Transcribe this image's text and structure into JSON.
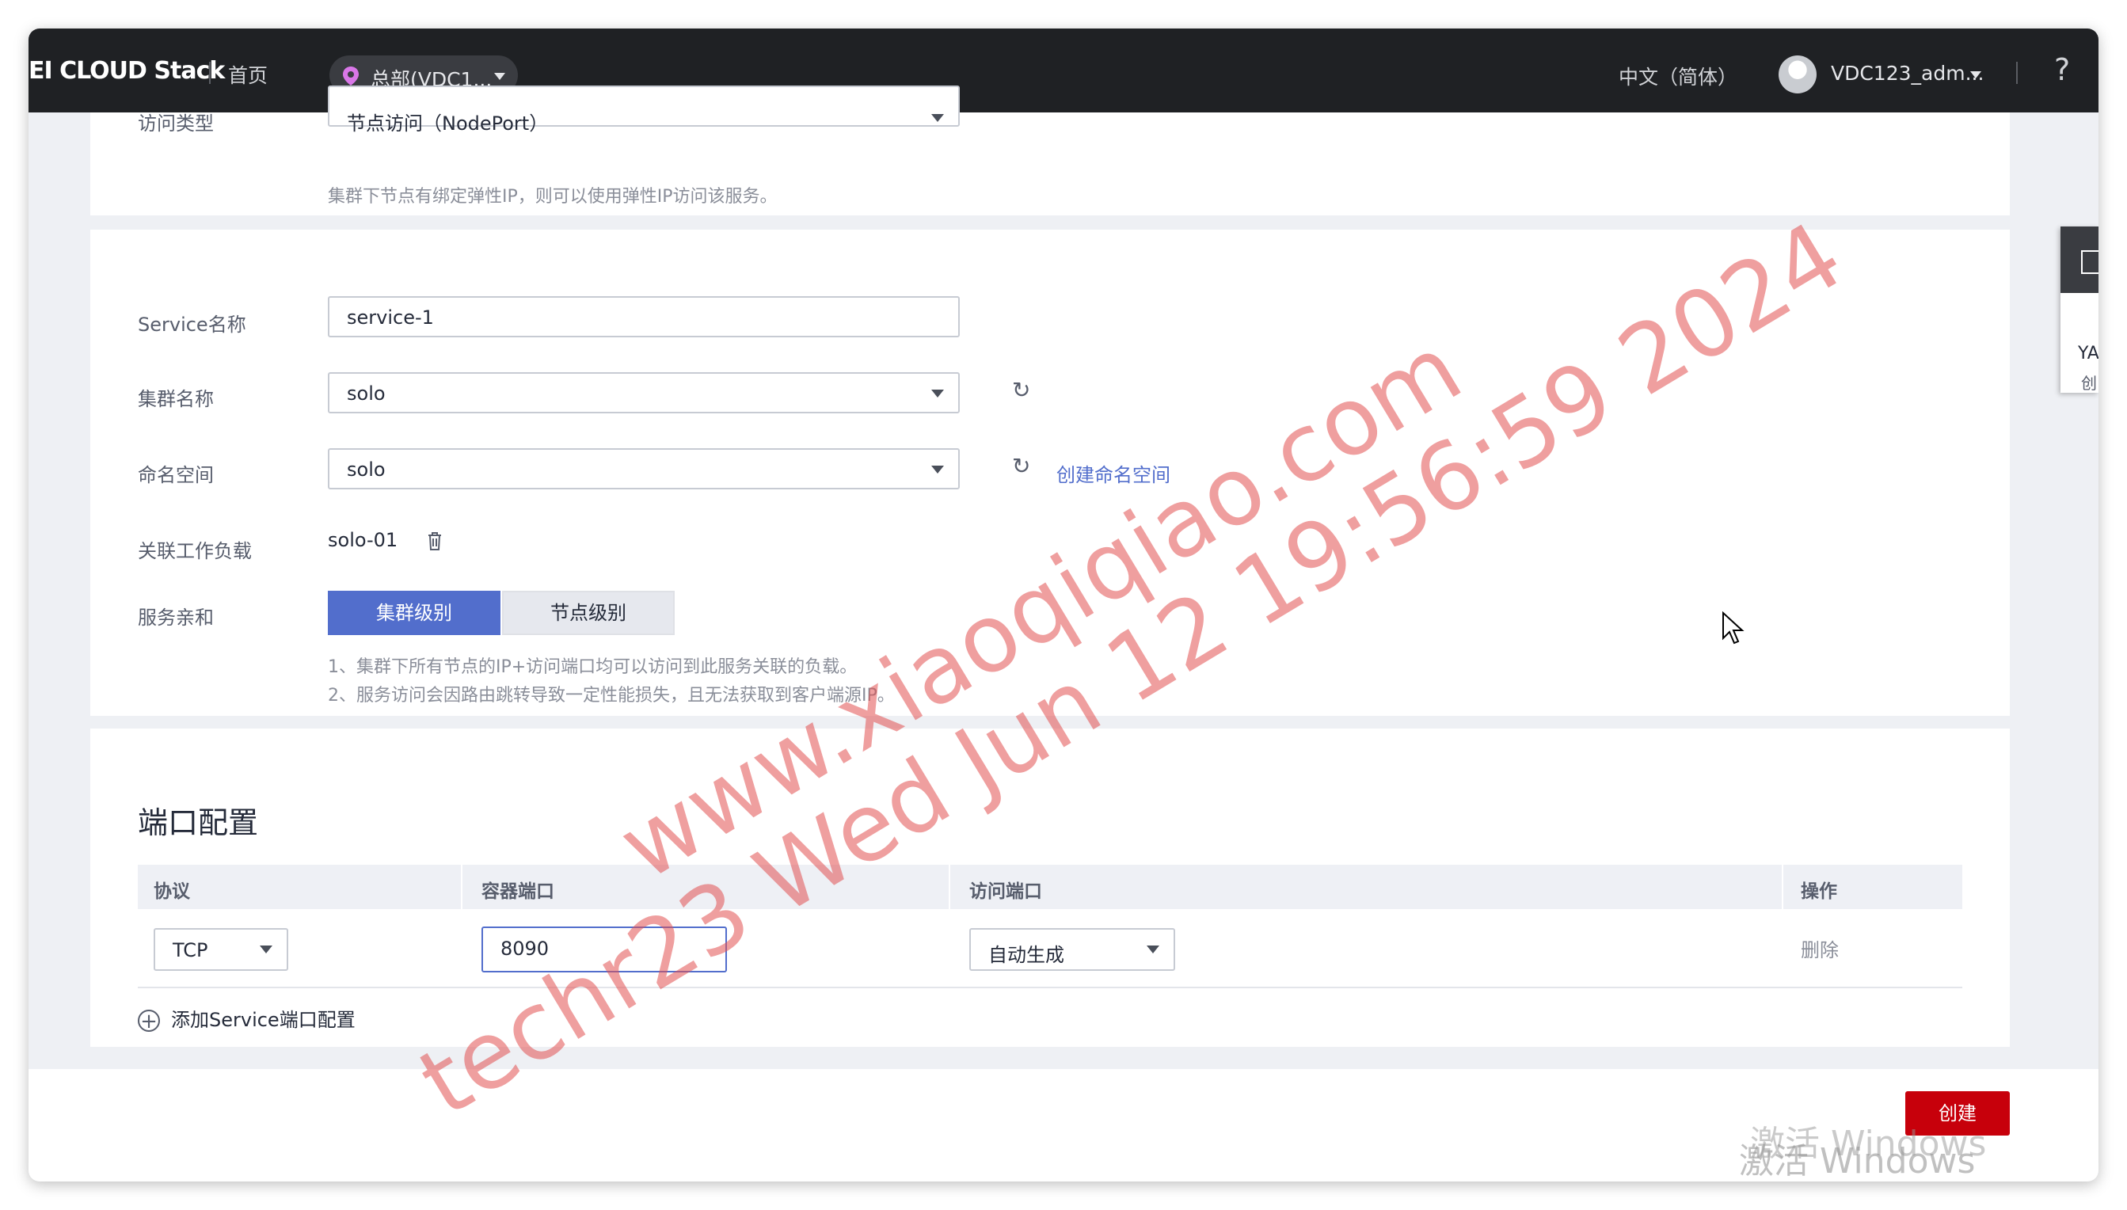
{
  "topbar": {
    "brand": "EI CLOUD Stack",
    "home": "首页",
    "region": "总部(VDC1...",
    "language": "中文（简体）",
    "user": "VDC123_adm...",
    "help": "?"
  },
  "access": {
    "label": "访问类型",
    "value": "节点访问（NodePort）",
    "hint": "集群下节点有绑定弹性IP，则可以使用弹性IP访问该服务。"
  },
  "service": {
    "name_label": "Service名称",
    "name_value": "service-1",
    "cluster_label": "集群名称",
    "cluster_value": "solo",
    "namespace_label": "命名空间",
    "namespace_value": "solo",
    "create_namespace_link": "创建命名空间",
    "workload_label": "关联工作负载",
    "workload_value": "solo-01",
    "affinity_label": "服务亲和",
    "affinity_options": [
      "集群级别",
      "节点级别"
    ],
    "affinity_notes": [
      "1、集群下所有节点的IP+访问端口均可以访问到此服务关联的负载。",
      "2、服务访问会因路由跳转导致一定性能损失，且无法获取到客户端源IP。"
    ]
  },
  "ports": {
    "title": "端口配置",
    "columns": [
      "协议",
      "容器端口",
      "访问端口",
      "操作"
    ],
    "rows": [
      {
        "protocol": "TCP",
        "container_port": "8090",
        "access_port": "自动生成",
        "action": "删除"
      }
    ],
    "add_label": "添加Service端口配置"
  },
  "footer": {
    "create_button": "创建"
  },
  "side_tab": {
    "line1": "YA",
    "line2": "创"
  },
  "watermark": {
    "line1": "www.xiaoqiqiao.com",
    "line2": "techr23 Wed Jun 12 19:56:59 2024",
    "activate": "激活 Windows"
  }
}
